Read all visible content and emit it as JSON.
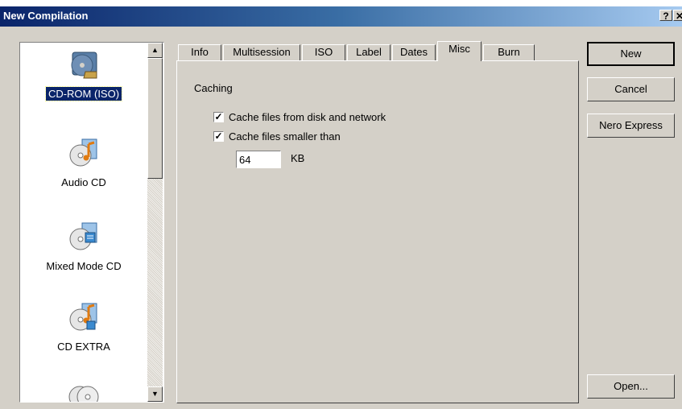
{
  "window": {
    "title": "New Compilation",
    "help_button": "?",
    "close_button": "✕"
  },
  "sidebar": {
    "items": [
      {
        "label": "CD-ROM (ISO)",
        "icon": "cd-rom-iso-icon",
        "selected": true
      },
      {
        "label": "Audio CD",
        "icon": "audio-cd-icon",
        "selected": false
      },
      {
        "label": "Mixed Mode CD",
        "icon": "mixed-mode-cd-icon",
        "selected": false
      },
      {
        "label": "CD EXTRA",
        "icon": "cd-extra-icon",
        "selected": false
      },
      {
        "label": "",
        "icon": "disc-copy-icon",
        "selected": false
      }
    ]
  },
  "tabs": [
    {
      "label": "Info"
    },
    {
      "label": "Multisession"
    },
    {
      "label": "ISO"
    },
    {
      "label": "Label"
    },
    {
      "label": "Dates"
    },
    {
      "label": "Misc",
      "active": true
    },
    {
      "label": "Burn"
    }
  ],
  "misc": {
    "group_label": "Caching",
    "cache_from_disk_label": "Cache files from disk and network",
    "cache_from_disk_checked": true,
    "cache_smaller_label": "Cache files smaller than",
    "cache_smaller_checked": true,
    "size_value": "64",
    "size_unit": "KB"
  },
  "buttons": {
    "new": "New",
    "cancel": "Cancel",
    "nero_express": "Nero Express",
    "open": "Open..."
  },
  "colors": {
    "title_start": "#0a246a",
    "title_end": "#a6caf0",
    "selection": "#0a246a",
    "face": "#d4d0c8"
  }
}
